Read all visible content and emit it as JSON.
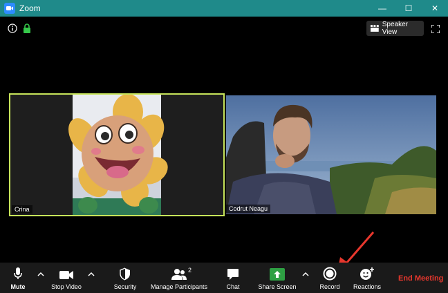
{
  "window": {
    "title": "Zoom",
    "controls": {
      "minimize": "—",
      "maximize": "☐",
      "close": "✕"
    }
  },
  "header": {
    "speaker_view_label": "Speaker View"
  },
  "participants": [
    {
      "name": "Crina",
      "active_speaker": true
    },
    {
      "name": "Codrut Neagu",
      "active_speaker": false
    }
  ],
  "toolbar": {
    "mute_label": "Mute",
    "stop_video_label": "Stop Video",
    "security_label": "Security",
    "manage_participants_label": "Manage Participants",
    "participant_count": "2",
    "chat_label": "Chat",
    "share_screen_label": "Share Screen",
    "record_label": "Record",
    "reactions_label": "Reactions",
    "end_meeting_label": "End Meeting"
  },
  "colors": {
    "titlebar": "#1f8a8a",
    "active_speaker_border": "#c7e45a",
    "share_green": "#2ea043",
    "end_meeting": "#e8372d",
    "annotation_arrow": "#e8372d"
  },
  "icons": [
    "zoom-app-icon",
    "info-icon",
    "lock-icon",
    "grid-icon",
    "fullscreen-icon",
    "microphone-icon",
    "video-camera-icon",
    "shield-icon",
    "participants-icon",
    "chat-bubble-icon",
    "share-screen-icon",
    "record-icon",
    "reactions-icon",
    "chevron-up-icon"
  ]
}
